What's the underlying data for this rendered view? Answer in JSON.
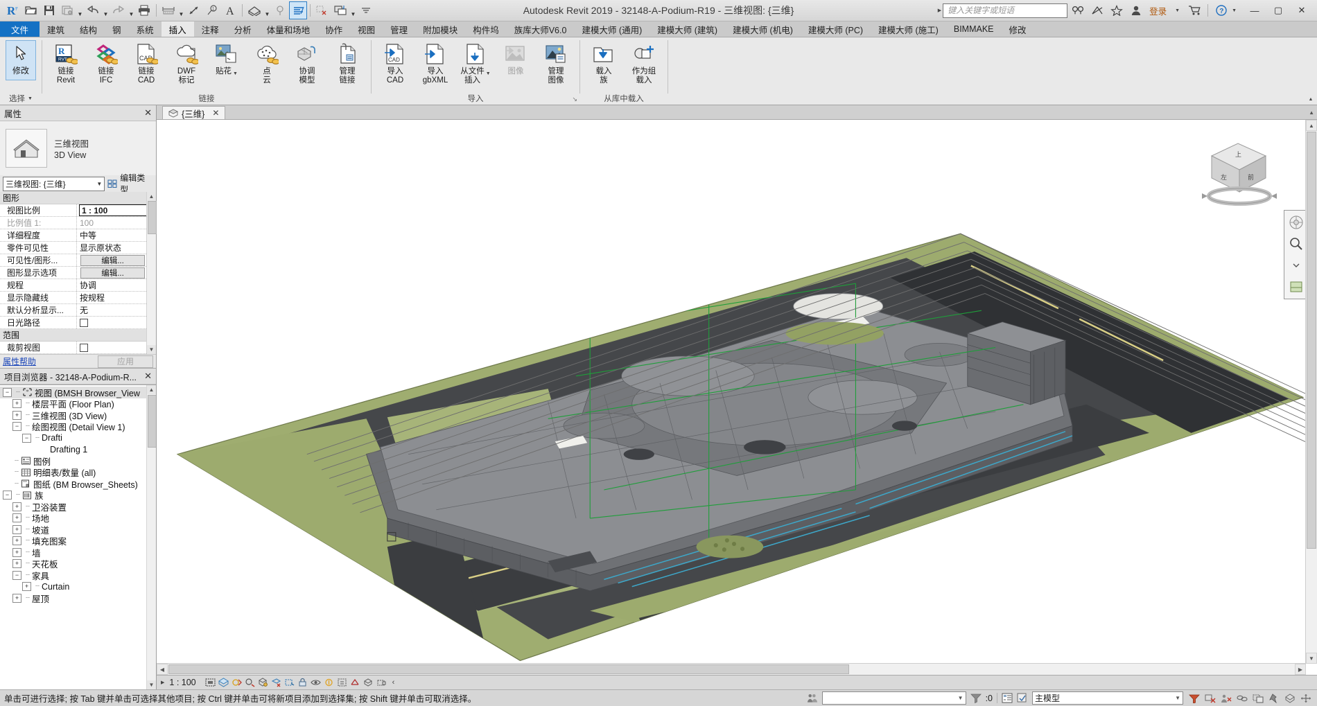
{
  "window": {
    "title": "Autodesk Revit 2019 - 32148-A-Podium-R19 - 三维视图: {三维}",
    "minimize": "—",
    "maximize": "▢",
    "close": "✕"
  },
  "quick_access": {
    "items": [
      {
        "name": "revit-logo-icon",
        "label": "R"
      },
      {
        "name": "open-icon",
        "label": ""
      },
      {
        "name": "save-icon",
        "label": ""
      },
      {
        "name": "save-as-icon",
        "label": ""
      },
      {
        "name": "undo-icon",
        "label": ""
      },
      {
        "name": "redo-icon",
        "label": ""
      },
      {
        "name": "print-icon",
        "label": ""
      },
      {
        "name": "measure-icon",
        "label": ""
      },
      {
        "name": "aligned-dimension-icon",
        "label": ""
      },
      {
        "name": "tag-icon",
        "label": ""
      },
      {
        "name": "text-icon",
        "label": "A"
      },
      {
        "name": "default-3d-view-icon",
        "label": ""
      },
      {
        "name": "section-icon",
        "label": ""
      },
      {
        "name": "thin-lines-icon",
        "label": ""
      },
      {
        "name": "close-hidden-windows-icon",
        "label": ""
      },
      {
        "name": "switch-windows-icon",
        "label": ""
      },
      {
        "name": "customize-qat-icon",
        "label": ""
      }
    ]
  },
  "search": {
    "placeholder": "键入关键字或短语",
    "signin": "登录"
  },
  "tabs": [
    {
      "label": "文件",
      "state": "file"
    },
    {
      "label": "建筑",
      "state": "normal"
    },
    {
      "label": "结构",
      "state": "normal"
    },
    {
      "label": "钢",
      "state": "normal"
    },
    {
      "label": "系统",
      "state": "normal"
    },
    {
      "label": "插入",
      "state": "active"
    },
    {
      "label": "注释",
      "state": "normal"
    },
    {
      "label": "分析",
      "state": "normal"
    },
    {
      "label": "体量和场地",
      "state": "normal"
    },
    {
      "label": "协作",
      "state": "normal"
    },
    {
      "label": "视图",
      "state": "normal"
    },
    {
      "label": "管理",
      "state": "normal"
    },
    {
      "label": "附加模块",
      "state": "normal"
    },
    {
      "label": "构件坞",
      "state": "normal"
    },
    {
      "label": "族库大师V6.0",
      "state": "normal"
    },
    {
      "label": "建模大师 (通用)",
      "state": "normal"
    },
    {
      "label": "建模大师 (建筑)",
      "state": "normal"
    },
    {
      "label": "建模大师 (机电)",
      "state": "normal"
    },
    {
      "label": "建模大师 (PC)",
      "state": "normal"
    },
    {
      "label": "建模大师 (施工)",
      "state": "normal"
    },
    {
      "label": "BIMMAKE",
      "state": "normal"
    },
    {
      "label": "修改",
      "state": "normal"
    }
  ],
  "ribbon": {
    "select_panel": {
      "button": "修改",
      "title": "选择"
    },
    "link_panel": {
      "title": "链接",
      "buttons": [
        {
          "name": "link-revit-button",
          "l1": "链接",
          "l2": "Revit",
          "icon": "link-revit-icon"
        },
        {
          "name": "link-ifc-button",
          "l1": "链接",
          "l2": "IFC",
          "icon": "link-ifc-icon"
        },
        {
          "name": "link-cad-button",
          "l1": "链接",
          "l2": "CAD",
          "icon": "link-cad-icon"
        },
        {
          "name": "dwf-markup-button",
          "l1": "DWF",
          "l2": "标记",
          "icon": "dwf-markup-icon"
        },
        {
          "name": "decal-button",
          "l1": "贴花",
          "l2": "",
          "icon": "decal-icon",
          "dropdown": true
        },
        {
          "name": "point-cloud-button",
          "l1": "点",
          "l2": "云",
          "icon": "point-cloud-icon"
        },
        {
          "name": "coordination-model-button",
          "l1": "协调",
          "l2": "模型",
          "icon": "coordination-model-icon"
        },
        {
          "name": "manage-links-button",
          "l1": "管理",
          "l2": "链接",
          "icon": "manage-links-icon"
        }
      ]
    },
    "import_panel": {
      "title": "导入",
      "buttons": [
        {
          "name": "import-cad-button",
          "l1": "导入",
          "l2": "CAD",
          "icon": "import-cad-icon"
        },
        {
          "name": "import-gbxml-button",
          "l1": "导入",
          "l2": "gbXML",
          "icon": "import-gbxml-icon"
        },
        {
          "name": "insert-from-file-button",
          "l1": "从文件",
          "l2": "插入",
          "icon": "insert-from-file-icon",
          "dropdown": true
        },
        {
          "name": "image-button",
          "l1": "图像",
          "l2": "",
          "icon": "image-icon",
          "disabled": true
        },
        {
          "name": "manage-images-button",
          "l1": "管理",
          "l2": "图像",
          "icon": "manage-images-icon"
        }
      ]
    },
    "library_panel": {
      "title": "从库中载入",
      "buttons": [
        {
          "name": "load-family-button",
          "l1": "载入",
          "l2": "族",
          "icon": "load-family-icon"
        },
        {
          "name": "load-as-group-button",
          "l1": "作为组",
          "l2": "载入",
          "icon": "load-as-group-icon"
        }
      ]
    }
  },
  "properties": {
    "header": "属性",
    "close": "✕",
    "type_name_1": "三维视图",
    "type_name_2": "3D View",
    "selector_value": "三维视图: {三维}",
    "edit_type": "编辑类型",
    "groups": [
      {
        "name": "图形",
        "rows": [
          {
            "k": "视图比例",
            "v": "1 : 100",
            "style": "boxed"
          },
          {
            "k": "比例值 1:",
            "v": "100",
            "style": "dimmed"
          },
          {
            "k": "详细程度",
            "v": "中等",
            "style": "normal"
          },
          {
            "k": "零件可见性",
            "v": "显示原状态",
            "style": "normal"
          },
          {
            "k": "可见性/图形...",
            "v": "编辑...",
            "style": "button"
          },
          {
            "k": "图形显示选项",
            "v": "编辑...",
            "style": "button"
          },
          {
            "k": "规程",
            "v": "协调",
            "style": "normal"
          },
          {
            "k": "显示隐藏线",
            "v": "按规程",
            "style": "normal"
          },
          {
            "k": "默认分析显示...",
            "v": "无",
            "style": "normal"
          },
          {
            "k": "日光路径",
            "v": "",
            "style": "checkbox"
          }
        ]
      },
      {
        "name": "范围",
        "rows": [
          {
            "k": "裁剪视图",
            "v": "",
            "style": "checkbox"
          }
        ]
      }
    ],
    "help_link": "属性帮助",
    "apply_button": "应用"
  },
  "browser": {
    "header": "项目浏览器 - 32148-A-Podium-R...",
    "close": "✕",
    "nodes": [
      {
        "label": "视图 (BMSH Browser_View",
        "indent": 0,
        "toggle": "minus",
        "icon": "views-icon",
        "selected": true
      },
      {
        "label": "楼层平面 (Floor Plan)",
        "indent": 1,
        "toggle": "plus",
        "icon": "none"
      },
      {
        "label": "三维视图 (3D View)",
        "indent": 1,
        "toggle": "plus",
        "icon": "none"
      },
      {
        "label": "绘图视图 (Detail View 1)",
        "indent": 1,
        "toggle": "minus",
        "icon": "none"
      },
      {
        "label": "Drafti",
        "indent": 2,
        "toggle": "minus",
        "icon": "none"
      },
      {
        "label": "Drafting 1",
        "indent": 3,
        "toggle": "none",
        "icon": "none"
      },
      {
        "label": "图例",
        "indent": 0,
        "toggle": "leaf",
        "icon": "legend-icon"
      },
      {
        "label": "明细表/数量 (all)",
        "indent": 0,
        "toggle": "leaf",
        "icon": "schedule-icon"
      },
      {
        "label": "图纸 (BM Browser_Sheets)",
        "indent": 0,
        "toggle": "leaf",
        "icon": "sheet-icon"
      },
      {
        "label": "族",
        "indent": 0,
        "toggle": "minus",
        "icon": "family-icon"
      },
      {
        "label": "卫浴装置",
        "indent": 1,
        "toggle": "plus",
        "icon": "none"
      },
      {
        "label": "场地",
        "indent": 1,
        "toggle": "plus",
        "icon": "none"
      },
      {
        "label": "坡道",
        "indent": 1,
        "toggle": "plus",
        "icon": "none"
      },
      {
        "label": "填充图案",
        "indent": 1,
        "toggle": "plus",
        "icon": "none"
      },
      {
        "label": "墙",
        "indent": 1,
        "toggle": "plus",
        "icon": "none"
      },
      {
        "label": "天花板",
        "indent": 1,
        "toggle": "plus",
        "icon": "none"
      },
      {
        "label": "家具",
        "indent": 1,
        "toggle": "minus",
        "icon": "none"
      },
      {
        "label": "Curtain",
        "indent": 2,
        "toggle": "plus",
        "icon": "none"
      },
      {
        "label": "屋顶",
        "indent": 1,
        "toggle": "plus",
        "icon": "none"
      }
    ]
  },
  "view": {
    "tab_label": "{三维}",
    "tab_close": "✕",
    "viewcube": {
      "top": "上",
      "left": "左",
      "front": "前"
    }
  },
  "view_control_bar": {
    "scale": "1 : 100",
    "icons": [
      "detail-level-icon",
      "visual-style-icon",
      "sun-path-icon",
      "shadows-icon",
      "render-icon",
      "crop-region-icon",
      "show-crop-icon",
      "lock-3d-view-icon",
      "temporary-hide-isolate-icon",
      "reveal-hidden-icon",
      "temporary-view-properties-icon",
      "show-analytical-model-icon",
      "highlight-displacement-icon",
      "constraints-icon"
    ],
    "expand": "‹"
  },
  "status_bar": {
    "message": "单击可进行选择; 按 Tab 键并单击可选择其他项目; 按 Ctrl 键并单击可将新项目添加到选择集; 按 Shift 键并单击可取消选择。",
    "workset_value": "",
    "filter_count": ":0",
    "design_option_value": "主模型",
    "right_icons": [
      "filter-icon",
      "exclude-options-icon",
      "editable-only-icon",
      "select-links-icon",
      "select-underlay-icon",
      "select-pinned-icon",
      "select-by-face-icon",
      "drag-elements-icon"
    ]
  },
  "colors": {
    "accent": "#1471c4",
    "file_tab": "#1471c4",
    "signin": "#b05a10",
    "link": "#1a45b8",
    "ground_green": "#9aa96a",
    "road_dark": "#3a3a3a",
    "building_gray": "#8d8d8d"
  }
}
